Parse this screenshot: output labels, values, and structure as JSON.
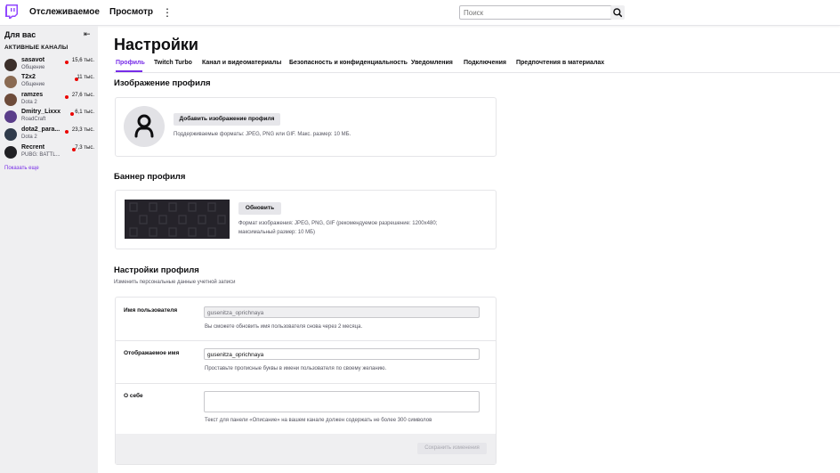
{
  "colors": {
    "accent": "#772ce8",
    "live": "#eb0400",
    "sidebar_bg": "#efeff1"
  },
  "topbar": {
    "logo_icon": "twitch-glitch-icon",
    "nav": [
      "Отслеживаемое",
      "Просмотр"
    ],
    "more_icon": "more-vertical-icon",
    "search_placeholder": "Поиск",
    "search_icon": "search-icon"
  },
  "sidebar": {
    "title": "Для вас",
    "collapse_icon": "collapse-arrow-icon",
    "subtitle": "АКТИВНЫЕ КАНАЛЫ",
    "channels": [
      {
        "name": "sasavot",
        "game": "Общение",
        "viewers": "15,6 тыс.",
        "avatar_color": "#3b2f2a"
      },
      {
        "name": "T2x2",
        "game": "Общение",
        "viewers": "11 тыс.",
        "avatar_color": "#8a6a52"
      },
      {
        "name": "ramzes",
        "game": "Dota 2",
        "viewers": "27,6 тыс.",
        "avatar_color": "#6d4b3a"
      },
      {
        "name": "Dmitry_Lixxx",
        "game": "RoadCraft",
        "viewers": "6,1 тыс.",
        "avatar_color": "#5a3d8a"
      },
      {
        "name": "dota2_para...",
        "game": "Dota 2",
        "viewers": "23,3 тыс.",
        "avatar_color": "#2f3a4a"
      },
      {
        "name": "Recrent",
        "game": "PUBG: BATTL...",
        "viewers": "7,3 тыс.",
        "avatar_color": "#202024"
      }
    ],
    "show_more": "Показать еще"
  },
  "main": {
    "title": "Настройки",
    "tabs": [
      "Профиль",
      "Twitch Turbo",
      "Канал и видеоматериалы",
      "Безопасность и конфиденциальность",
      "Уведомления",
      "Подключения",
      "Предпочтения в материалах"
    ],
    "active_tab": "Профиль",
    "profile_image": {
      "heading": "Изображение профиля",
      "button": "Добавить изображение профиля",
      "hint": "Поддерживаемые форматы: JPEG, PNG или GIF. Макс. размер: 10 МБ."
    },
    "banner": {
      "heading": "Баннер профиля",
      "button": "Обновить",
      "hint_line1": "Формат изображения: JPEG, PNG, GIF (рекомендуемое разрешение: 1200x480;",
      "hint_line2": "максимальный размер: 10 МБ)"
    },
    "profile_settings": {
      "heading": "Настройки профиля",
      "subheading": "Изменить персональные данные учетной записи",
      "username_label": "Имя пользователя",
      "username_value": "gusenitza_oprichnaya",
      "username_hint": "Вы сможете обновить имя пользователя снова через 2 месяца.",
      "display_label": "Отображаемое имя",
      "display_value": "gusenitza_oprichnaya",
      "display_hint": "Проставьте прописные буквы в имени пользователя по своему желанию.",
      "bio_label": "О себе",
      "bio_value": "",
      "bio_hint": "Текст для панели «Описание» на вашем канале должен содержать не более 300 символов",
      "save_button": "Сохранить изменения"
    }
  }
}
